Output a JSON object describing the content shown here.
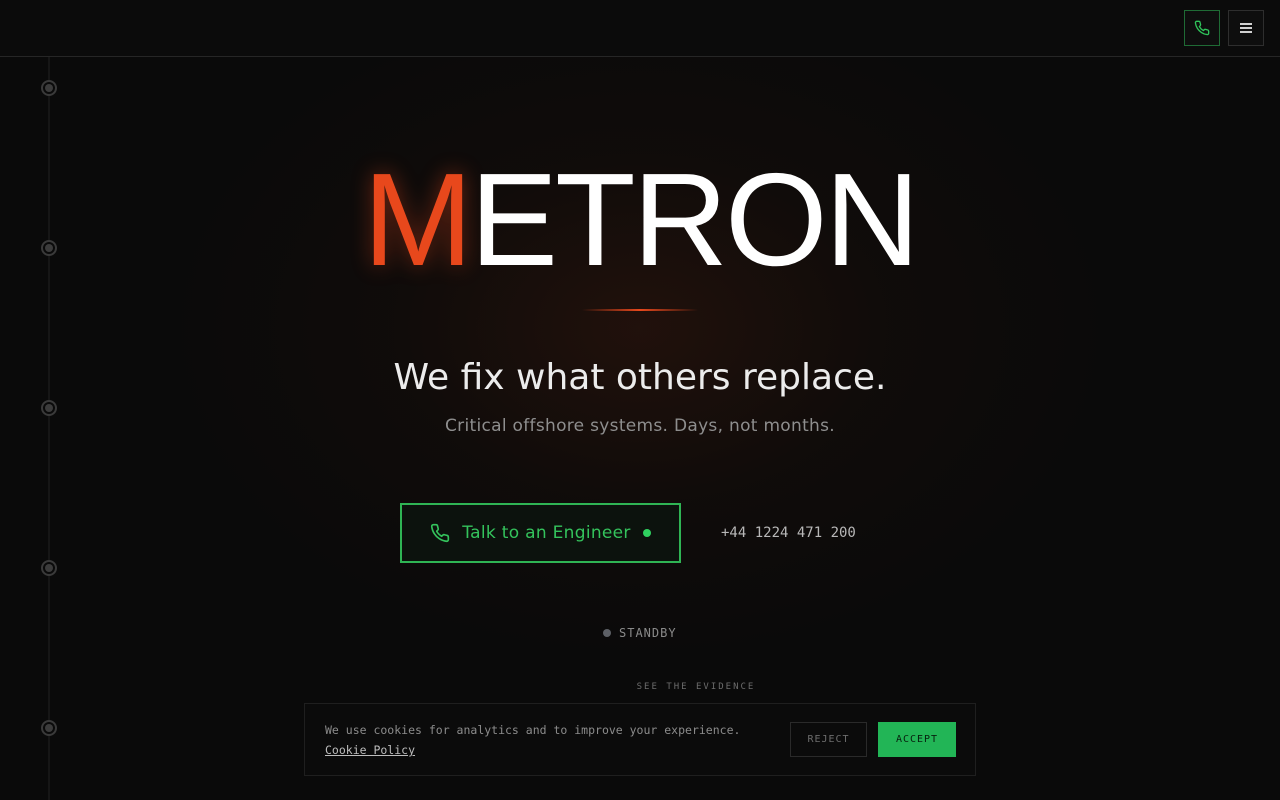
{
  "header": {
    "phone_icon": "phone-icon",
    "menu_icon": "hamburger-menu-icon"
  },
  "hero": {
    "logo_first": "M",
    "logo_rest": "ETRON",
    "headline": "We fix what others replace.",
    "subline": "Critical offshore systems. Days, not months.",
    "cta_label": "Talk to an Engineer",
    "phone_number": "+44 1224 471 200",
    "status": "STANDBY",
    "evidence_label": "SEE THE EVIDENCE"
  },
  "cookie_banner": {
    "text": "We use cookies for analytics and to improve your experience.",
    "policy_link": "Cookie Policy",
    "reject_label": "REJECT",
    "accept_label": "ACCEPT"
  },
  "colors": {
    "brand_accent": "#e8481c",
    "cta_green": "#2fb454",
    "accept_green": "#22b556",
    "background": "#0a0a0a"
  }
}
